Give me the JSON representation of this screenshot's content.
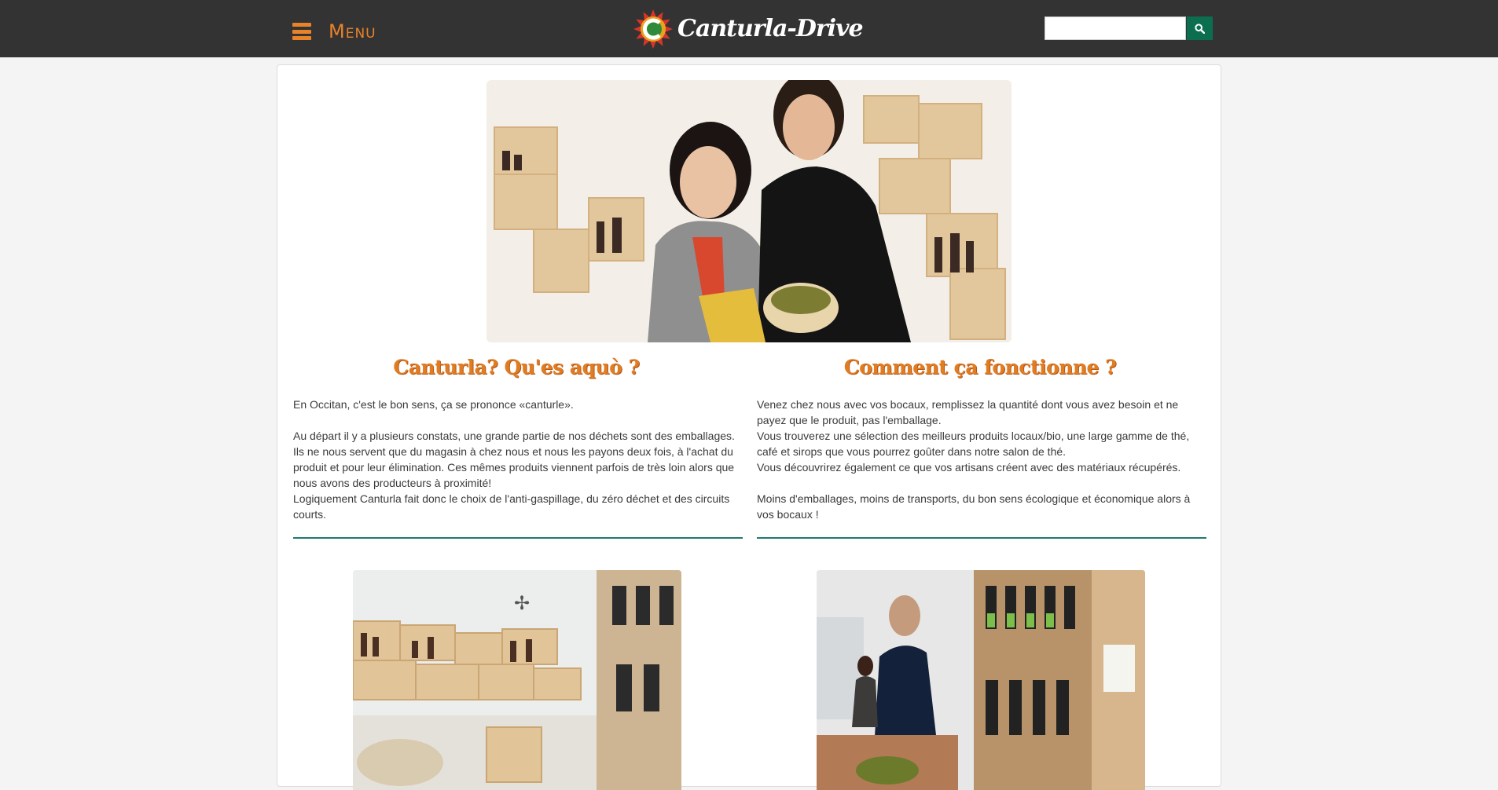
{
  "header": {
    "menu_label": "Menu",
    "logo_text": "Canturla-Drive",
    "search": {
      "placeholder": "",
      "value": ""
    },
    "accent_color": "#e8832a",
    "search_button_color": "#0b6e4f",
    "background_color": "#333333"
  },
  "hero_image": {
    "alt": ""
  },
  "left_section": {
    "title": "Canturla? Qu'es aquò ?",
    "paragraphs": [
      "En Occitan, c'est le bon sens, ça se prononce «canturle».",
      "",
      "Au départ il y a plusieurs constats, une grande partie de nos déchets sont des emballages. Ils ne nous servent que du magasin à chez nous et nous les payons deux fois, à l'achat du produit et pour leur élimination. Ces mêmes produits viennent parfois de très loin alors que nous avons des producteurs à proximité!",
      "Logiquement Canturla fait donc le choix de l'anti-gaspillage, du zéro déchet et des circuits courts."
    ]
  },
  "right_section": {
    "title": "Comment ça fonctionne ?",
    "paragraphs": [
      "Venez chez nous avec vos bocaux, remplissez la quantité dont vous avez besoin et ne payez que le produit, pas l'emballage.",
      "Vous trouverez une sélection des meilleurs produits locaux/bio, une large gamme de thé, café et sirops que vous pourrez goûter dans notre salon de thé.",
      "Vous découvrirez également ce que vos artisans créent avec des matériaux récupérés.",
      "",
      "Moins d'emballages, moins de transports, du bon sens écologique et économique alors à vos bocaux !"
    ]
  },
  "title_color": "#e07d22",
  "divider_color": "#1f7a6e"
}
